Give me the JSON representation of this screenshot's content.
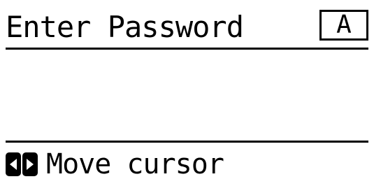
{
  "header": {
    "title": "Enter Password",
    "input_mode": "A"
  },
  "input": {
    "value": ""
  },
  "footer": {
    "left_key_icon": "left-arrow-key-icon",
    "right_key_icon": "right-arrow-key-icon",
    "hint": "Move cursor"
  },
  "colors": {
    "foreground": "#000000",
    "background": "#ffffff"
  }
}
